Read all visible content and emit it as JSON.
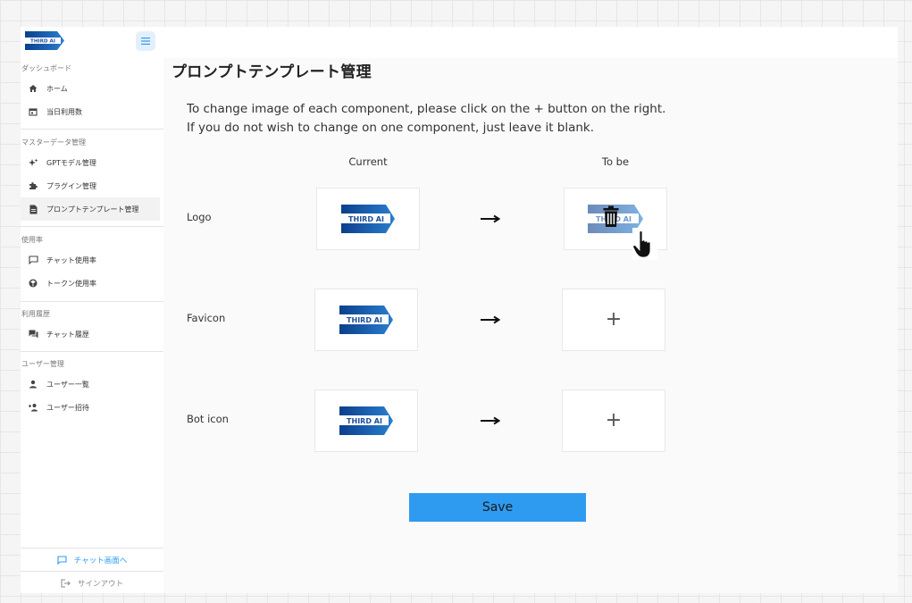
{
  "brand": {
    "name": "THIRD AI",
    "primary": "#1b4d9e",
    "accent": "#2e9bf0"
  },
  "sidebar": {
    "sections": [
      {
        "label": "ダッシュボード",
        "items": [
          {
            "label": "ホーム",
            "icon": "home-icon"
          },
          {
            "label": "当日利用数",
            "icon": "calendar-icon"
          }
        ]
      },
      {
        "label": "マスターデータ管理",
        "items": [
          {
            "label": "GPTモデル管理",
            "icon": "sparkle-icon"
          },
          {
            "label": "プラグイン管理",
            "icon": "puzzle-icon"
          },
          {
            "label": "プロンプトテンプレート管理",
            "icon": "document-icon",
            "active": true
          }
        ]
      },
      {
        "label": "使用率",
        "items": [
          {
            "label": "チャット使用率",
            "icon": "chat-bubble-icon"
          },
          {
            "label": "トークン使用率",
            "icon": "token-icon"
          }
        ]
      },
      {
        "label": "利用履歴",
        "items": [
          {
            "label": "チャット履歴",
            "icon": "chat-history-icon"
          }
        ]
      },
      {
        "label": "ユーザー管理",
        "items": [
          {
            "label": "ユーザー一覧",
            "icon": "person-icon"
          },
          {
            "label": "ユーザー招待",
            "icon": "person-add-icon"
          }
        ]
      }
    ],
    "footer": {
      "chat_link": "チャット画面へ",
      "signout": "サインアウト"
    }
  },
  "main": {
    "title": "プロンプトテンプレート管理",
    "instructions": [
      "To change image of each component, please click on the + button on the right.",
      "If you do not wish to change on one component, just leave it blank."
    ],
    "columns": {
      "current": "Current",
      "to_be": "To be"
    },
    "rows": [
      {
        "label": "Logo",
        "to_be_state": "uploaded-with-delete"
      },
      {
        "label": "Favicon",
        "to_be_state": "empty"
      },
      {
        "label": "Bot icon",
        "to_be_state": "empty"
      }
    ],
    "plus_symbol": "+",
    "save_label": "Save"
  }
}
